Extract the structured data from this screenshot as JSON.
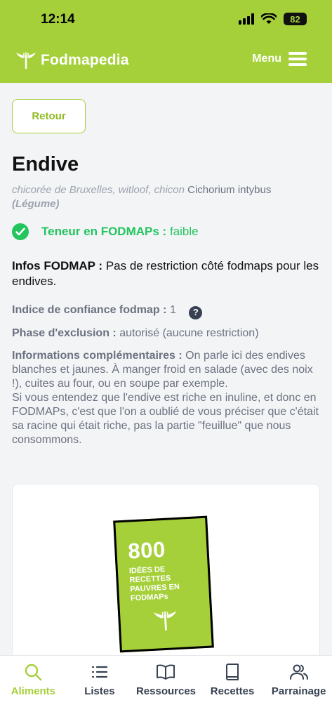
{
  "status_bar": {
    "time": "12:14",
    "battery": "82"
  },
  "header": {
    "app_name": "Fodmapedia",
    "menu_label": "Menu"
  },
  "page": {
    "back_label": "Retour",
    "title": "Endive",
    "synonyms": "chicorée de Bruxelles, witloof, chicon",
    "scientific_name": "Cichorium intybus",
    "category": "(Légume)",
    "fodmap_label": "Teneur en FODMAPs :",
    "fodmap_value": "faible",
    "infos_label": "Infos FODMAP :",
    "infos_value": "Pas de restriction côté fodmaps pour les endives.",
    "confidence_label": "Indice de confiance fodmap :",
    "confidence_value": "1",
    "exclusion_label": "Phase d'exclusion :",
    "exclusion_value": "autorisé (aucune restriction)",
    "complement_label": "Informations complémentaires :",
    "complement_value_1": "On parle ici des endives blanches et jaunes. À manger froid en salade (avec des noix !), cuites au four, ou en soupe par exemple.",
    "complement_value_2": "Si vous entendez que l'endive est riche en inuline, et donc en FODMAPs, c'est que l'on a oublié de vous préciser que c'était sa racine qui était riche, pas la partie \"feuillue\" que nous consommons."
  },
  "promo": {
    "number": "800",
    "text": "IDÉES DE RECETTES PAUVRES EN FODMAPs"
  },
  "bottom_nav": [
    {
      "label": "Aliments",
      "icon": "search-icon",
      "active": true
    },
    {
      "label": "Listes",
      "icon": "list-icon",
      "active": false
    },
    {
      "label": "Ressources",
      "icon": "open-book-icon",
      "active": false
    },
    {
      "label": "Recettes",
      "icon": "book-icon",
      "active": false
    },
    {
      "label": "Parrainage",
      "icon": "users-icon",
      "active": false
    }
  ],
  "colors": {
    "brand": "#a5d03a",
    "low_fodmap": "#22c55e"
  }
}
